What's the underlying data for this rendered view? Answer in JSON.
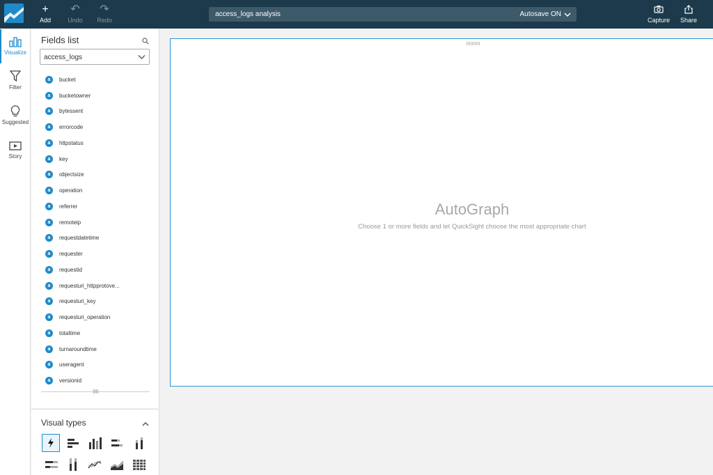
{
  "toolbar": {
    "add_label": "Add",
    "undo_label": "Undo",
    "redo_label": "Redo",
    "analysis_name": "access_logs analysis",
    "autosave_label": "Autosave ON",
    "capture_label": "Capture",
    "share_label": "Share"
  },
  "rail": {
    "visualize_label": "Visualize",
    "filter_label": "Filter",
    "suggested_label": "Suggested",
    "story_label": "Story"
  },
  "fields_panel": {
    "title": "Fields list",
    "dataset": "access_logs",
    "fields": [
      "bucket",
      "bucketowner",
      "bytessent",
      "errorcode",
      "httpstatus",
      "key",
      "objectsize",
      "operation",
      "referrer",
      "remoteip",
      "requestdatetime",
      "requester",
      "requestid",
      "requesturi_httpprotove...",
      "requesturi_key",
      "requesturi_operation",
      "totaltime",
      "turnaroundtime",
      "useragent",
      "versionid"
    ],
    "field_type_glyph": "a"
  },
  "visual_types": {
    "title": "Visual types",
    "icons": [
      "autograph-icon",
      "horizontal-bar-icon",
      "vertical-bar-icon",
      "stacked-horizontal-bar-icon",
      "stacked-vertical-bar-icon",
      "percent-horizontal-bar-icon",
      "percent-vertical-bar-icon",
      "line-chart-icon",
      "area-chart-icon",
      "pivot-table-icon"
    ]
  },
  "canvas": {
    "title": "AutoGraph",
    "subtitle": "Choose 1 or more fields and let QuickSight choose the most appropriate chart"
  },
  "colors": {
    "topbar": "#1c3a4b",
    "accent": "#1f8ac9",
    "canvas_bg": "#f2f2f2"
  }
}
